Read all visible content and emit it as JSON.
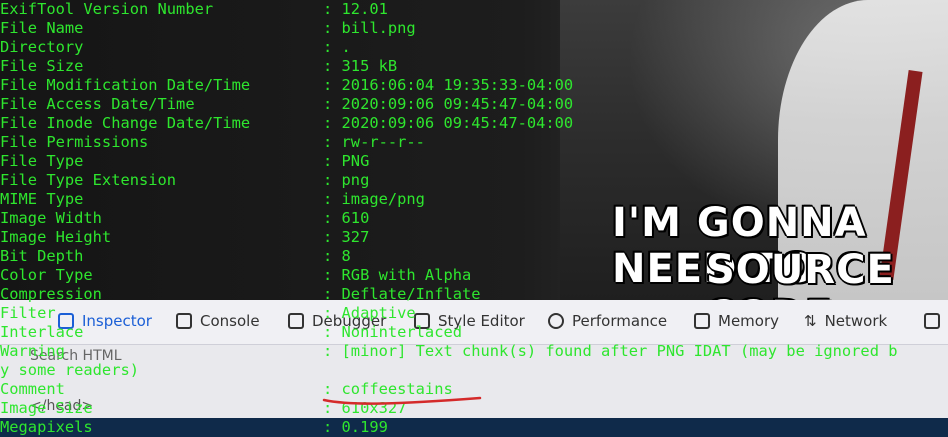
{
  "background": {
    "meme_line1": "I'M GONNA NEED TO",
    "meme_line2": "SOURCE CODE,"
  },
  "devtools": {
    "tabs": [
      "Inspector",
      "Console",
      "Debugger",
      "Style Editor",
      "Performance",
      "Memory",
      "Network"
    ],
    "search_placeholder": "Search HTML",
    "code_line": "</head>"
  },
  "terminal": {
    "rows": [
      {
        "key": "ExifTool Version Number",
        "value": ": 12.01"
      },
      {
        "key": "File Name",
        "value": ": bill.png"
      },
      {
        "key": "Directory",
        "value": ": ."
      },
      {
        "key": "File Size",
        "value": ": 315 kB"
      },
      {
        "key": "File Modification Date/Time",
        "value": ": 2016:06:04 19:35:33-04:00"
      },
      {
        "key": "File Access Date/Time",
        "value": ": 2020:09:06 09:45:47-04:00"
      },
      {
        "key": "File Inode Change Date/Time",
        "value": ": 2020:09:06 09:45:47-04:00"
      },
      {
        "key": "File Permissions",
        "value": ": rw-r--r--"
      },
      {
        "key": "File Type",
        "value": ": PNG"
      },
      {
        "key": "File Type Extension",
        "value": ": png"
      },
      {
        "key": "MIME Type",
        "value": ": image/png"
      },
      {
        "key": "Image Width",
        "value": ": 610"
      },
      {
        "key": "Image Height",
        "value": ": 327"
      },
      {
        "key": "Bit Depth",
        "value": ": 8"
      },
      {
        "key": "Color Type",
        "value": ": RGB with Alpha"
      },
      {
        "key": "Compression",
        "value": ": Deflate/Inflate"
      },
      {
        "key": "Filter",
        "value": ": Adaptive"
      },
      {
        "key": "Interlace",
        "value": ": Noninterlaced"
      },
      {
        "key": "Warning",
        "value": ": [minor] Text chunk(s) found after PNG IDAT (may be ignored b"
      },
      {
        "key": "y some readers)",
        "value": ""
      },
      {
        "key": "Comment",
        "value": ": coffeestains"
      },
      {
        "key": "Image Size",
        "value": ": 610x327"
      },
      {
        "key": "Megapixels",
        "value": ": 0.199"
      }
    ],
    "highlight_color": "#2ee62e",
    "underline_color": "#d42a2a"
  }
}
